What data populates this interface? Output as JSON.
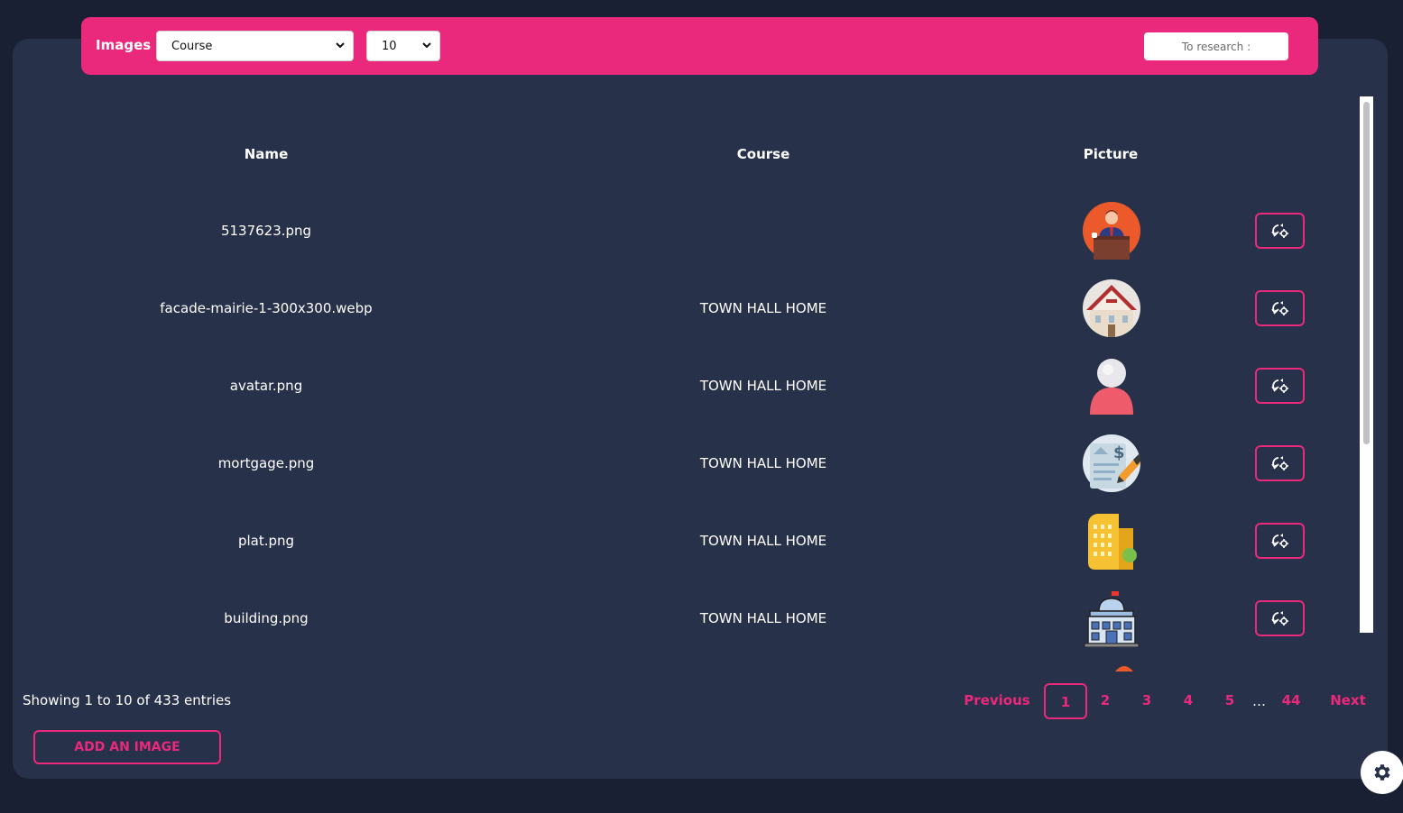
{
  "toolbar": {
    "title": "Images",
    "course_select": "Course",
    "count_select": "10",
    "search_placeholder": "To research :"
  },
  "table": {
    "headers": {
      "name": "Name",
      "course": "Course",
      "picture": "Picture"
    },
    "rows": [
      {
        "name": "5137623.png",
        "course": "",
        "picture_icon": "speaker-podium-icon"
      },
      {
        "name": "facade-mairie-1-300x300.webp",
        "course": "TOWN HALL HOME",
        "picture_icon": "town-hall-icon"
      },
      {
        "name": "avatar.png",
        "course": "TOWN HALL HOME",
        "picture_icon": "avatar-icon"
      },
      {
        "name": "mortgage.png",
        "course": "TOWN HALL HOME",
        "picture_icon": "mortgage-document-icon"
      },
      {
        "name": "plat.png",
        "course": "TOWN HALL HOME",
        "picture_icon": "apartment-building-icon"
      },
      {
        "name": "building.png",
        "course": "TOWN HALL HOME",
        "picture_icon": "government-building-icon"
      }
    ],
    "edit_icon": "edit-settings-icon"
  },
  "footer": {
    "info": "Showing 1 to 10 of 433 entries",
    "pagination": {
      "previous": "Previous",
      "pages": [
        "1",
        "2",
        "3",
        "4",
        "5"
      ],
      "ellipsis": "…",
      "last": "44",
      "next": "Next",
      "active": "1"
    },
    "add_button": "ADD AN IMAGE"
  },
  "colors": {
    "accent": "#ea287c",
    "panel": "#28314a",
    "background": "#1a2033"
  }
}
